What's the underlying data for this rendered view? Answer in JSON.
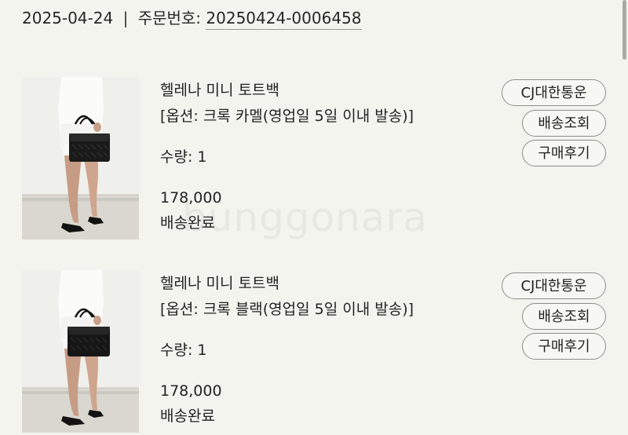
{
  "order": {
    "date": "2025-04-24",
    "separator": "|",
    "order_no_label": "주문번호:",
    "order_no": "20250424-0006458"
  },
  "items": [
    {
      "name": "헬레나 미니 토트백",
      "option": "[옵션: 크록 카멜(영업일 5일 이내 발송)]",
      "quantity": "수량: 1",
      "price": "178,000",
      "status": "배송완료",
      "carrier_button": "CJ대한통운",
      "track_button": "배송조회",
      "review_button": "구매후기"
    },
    {
      "name": "헬레나 미니 토트백",
      "option": "[옵션: 크록 블랙(영업일 5일 이내 발송)]",
      "quantity": "수량: 1",
      "price": "178,000",
      "status": "배송완료",
      "carrier_button": "CJ대한통운",
      "track_button": "배송조회",
      "review_button": "구매후기"
    }
  ],
  "watermark": "bunggonara"
}
